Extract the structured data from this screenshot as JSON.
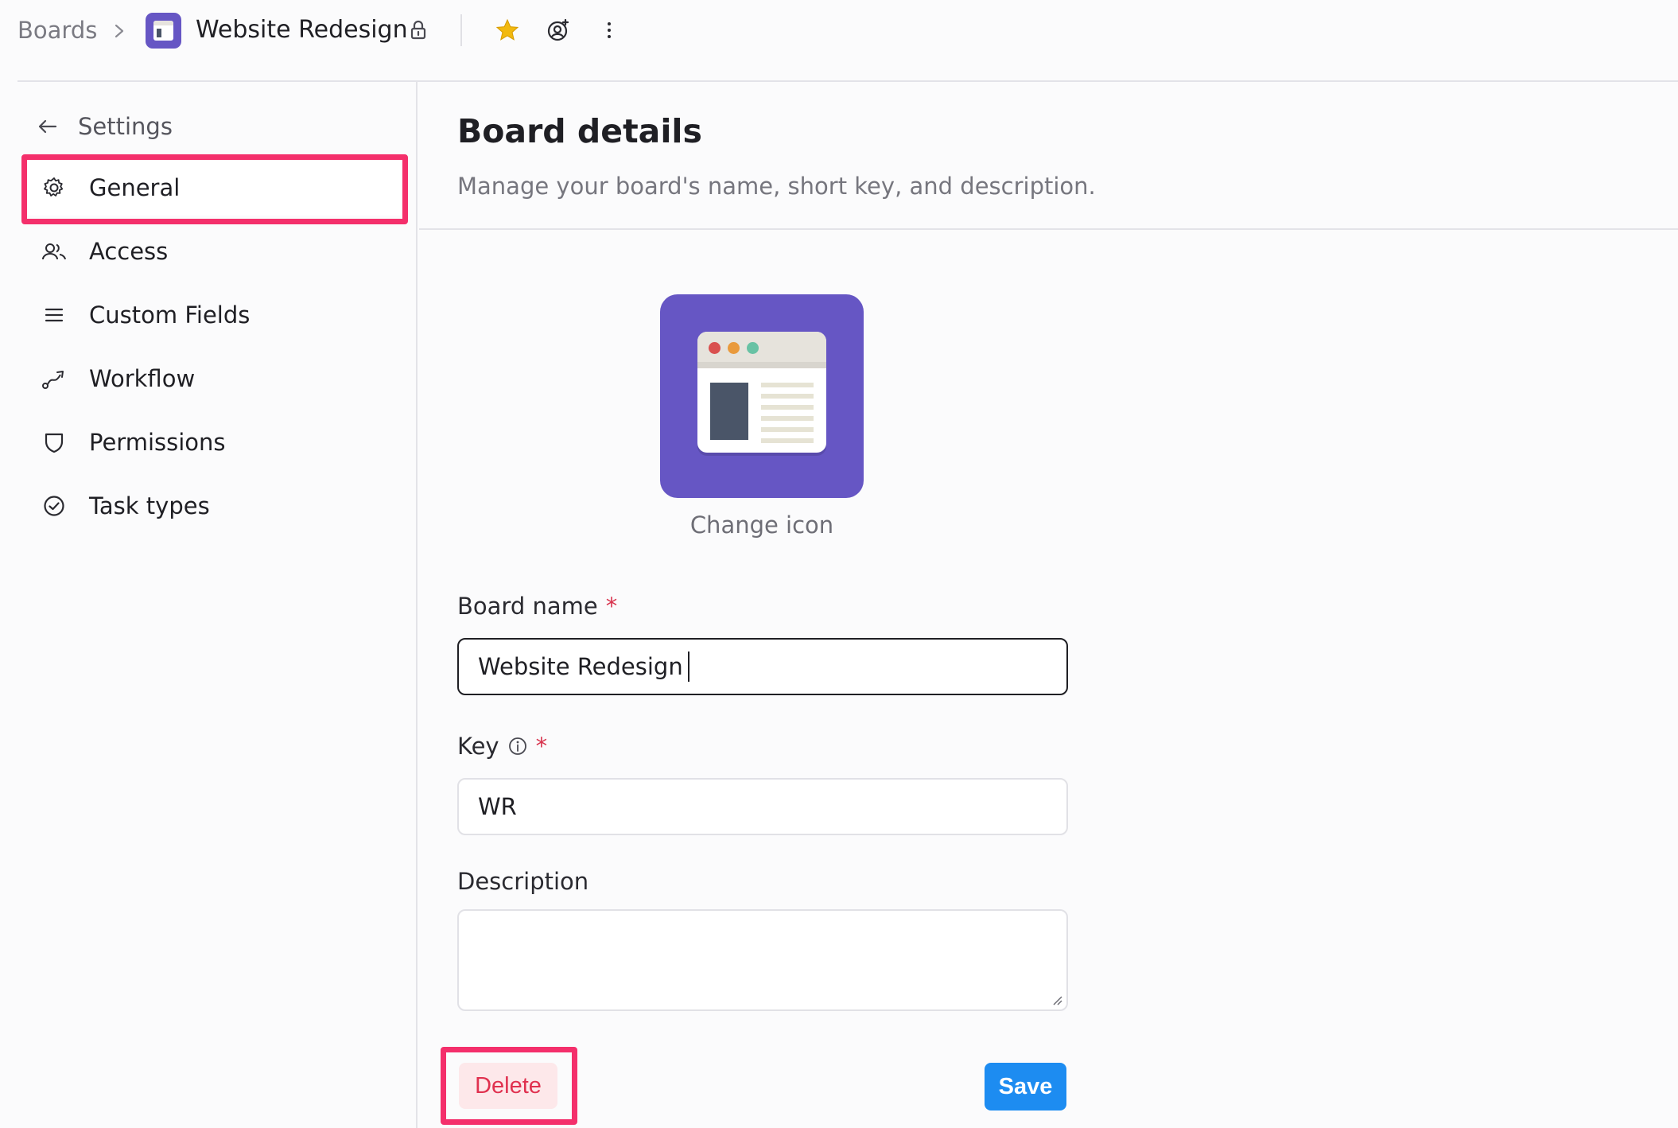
{
  "topbar": {
    "breadcrumb_root": "Boards",
    "board_title": "Website Redesign",
    "star_color": "#f2b90f"
  },
  "sidebar": {
    "back_label": "Settings",
    "items": [
      {
        "label": "General",
        "icon": "gear-icon",
        "active": true
      },
      {
        "label": "Access",
        "icon": "users-icon",
        "active": false
      },
      {
        "label": "Custom Fields",
        "icon": "list-icon",
        "active": false
      },
      {
        "label": "Workflow",
        "icon": "workflow-icon",
        "active": false
      },
      {
        "label": "Permissions",
        "icon": "shield-icon",
        "active": false
      },
      {
        "label": "Task types",
        "icon": "check-circle-icon",
        "active": false
      }
    ]
  },
  "main": {
    "title": "Board details",
    "subtitle": "Manage your board's name, short key, and description.",
    "change_icon_label": "Change icon",
    "board_name": {
      "label": "Board name",
      "required_mark": "*",
      "value": "Website Redesign"
    },
    "key": {
      "label": "Key",
      "required_mark": "*",
      "value": "WR"
    },
    "description": {
      "label": "Description",
      "value": ""
    },
    "delete_label": "Delete",
    "save_label": "Save"
  },
  "colors": {
    "accent": "#6656c4",
    "highlight": "#f42f6b",
    "save": "#1d8cf1",
    "danger": "#e0314f"
  }
}
